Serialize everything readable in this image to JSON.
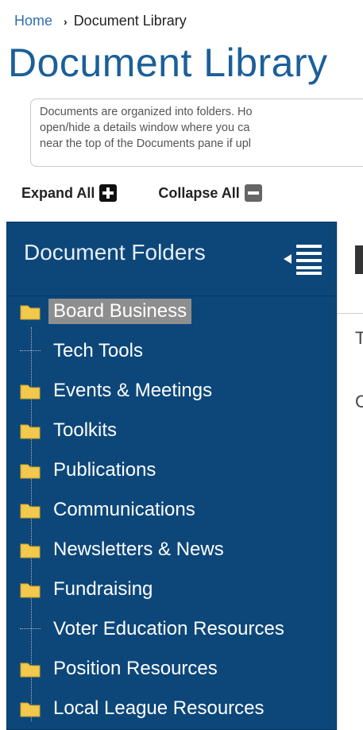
{
  "breadcrumb": {
    "home": "Home",
    "separator": "›",
    "current": "Document Library"
  },
  "page_title": "Document Library",
  "info_text": {
    "line1": "Documents are organized into folders. Ho",
    "line2": "open/hide a details window where you ca",
    "line3": "near the top of the Documents pane if upl"
  },
  "toolbar": {
    "expand_all": "Expand All",
    "collapse_all": "Collapse All"
  },
  "panel": {
    "title": "Document Folders",
    "items": [
      {
        "label": "Board Business",
        "icon": "folder-icon",
        "selected": true
      },
      {
        "label": "Tech Tools",
        "icon": "tree-leaf-line"
      },
      {
        "label": "Events & Meetings",
        "icon": "folder-icon"
      },
      {
        "label": "Toolkits",
        "icon": "folder-icon"
      },
      {
        "label": "Publications",
        "icon": "folder-icon"
      },
      {
        "label": "Communications",
        "icon": "folder-icon"
      },
      {
        "label": "Newsletters & News",
        "icon": "folder-icon"
      },
      {
        "label": "Fundraising",
        "icon": "folder-icon"
      },
      {
        "label": "Voter Education Resources",
        "icon": "tree-leaf-line"
      },
      {
        "label": "Position Resources",
        "icon": "folder-icon"
      },
      {
        "label": "Local League Resources",
        "icon": "folder-icon"
      }
    ]
  },
  "right_pane": {
    "char1": "T",
    "char2": "C"
  },
  "colors": {
    "panel_bg": "#0d477a",
    "title_blue": "#1b5f99",
    "link_blue": "#2f6fb2",
    "folder_yellow": "#f2c94c",
    "selected_bg": "#8e8e8e"
  }
}
